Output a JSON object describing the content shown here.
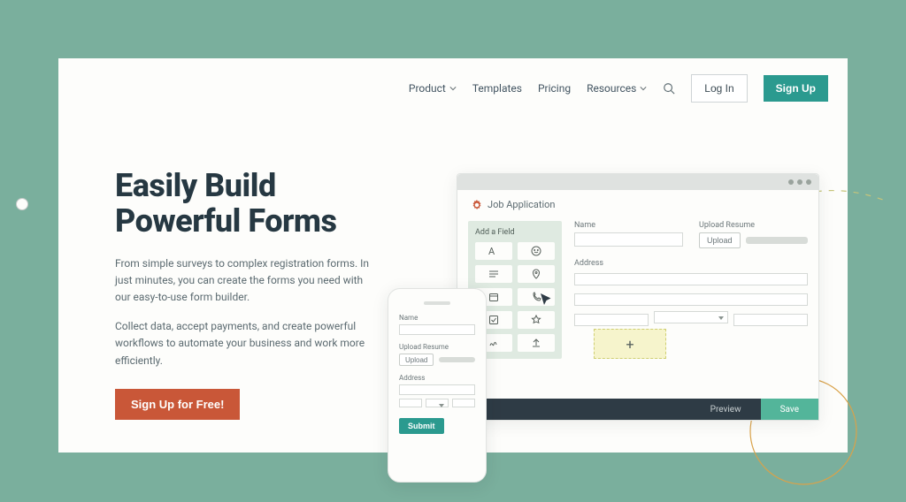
{
  "nav": {
    "product": "Product",
    "templates": "Templates",
    "pricing": "Pricing",
    "resources": "Resources",
    "login": "Log In",
    "signup": "Sign Up"
  },
  "hero": {
    "title_line1": "Easily Build",
    "title_line2": "Powerful Forms",
    "para1": "From simple surveys to complex registration forms. In just minutes, you can create the forms you need with our easy-to-use form builder.",
    "para2": "Collect data, accept payments, and create powerful workflows to automate your business and work more efficiently.",
    "cta": "Sign Up for Free!"
  },
  "builder": {
    "doc_title": "Job Application",
    "palette_title": "Add a Field",
    "labels": {
      "name": "Name",
      "upload_resume": "Upload Resume",
      "upload_btn": "Upload",
      "address": "Address",
      "submit": "Submit",
      "preview": "Preview",
      "save": "Save"
    },
    "add_icon": "+"
  },
  "colors": {
    "bg": "#7aaf9d",
    "accent": "#2b9a8f",
    "cta": "#c95738",
    "ink": "#263842"
  }
}
